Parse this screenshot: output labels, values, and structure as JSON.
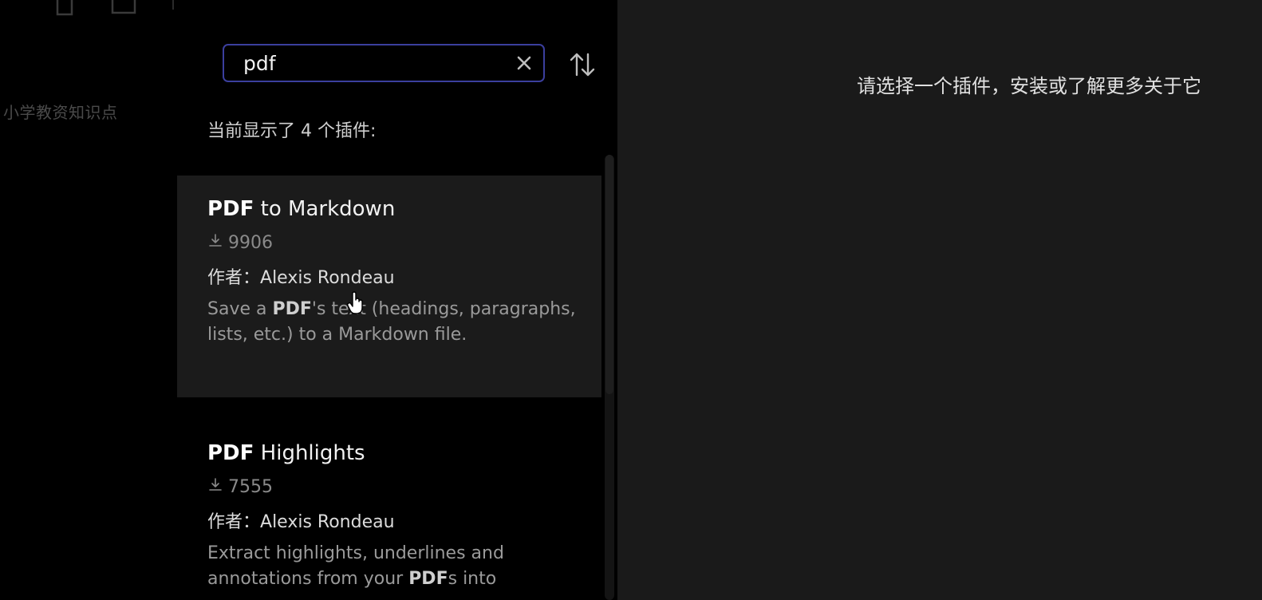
{
  "vault": {
    "name": "小学教资知识点"
  },
  "search": {
    "value": "pdf",
    "placeholder": ""
  },
  "results": {
    "count_text": "当前显示了 4 个插件:",
    "author_prefix": "作者：",
    "items": [
      {
        "title_highlight": "PDF",
        "title_rest": " to Markdown",
        "downloads": "9906",
        "author": "Alexis Rondeau",
        "desc_pre": "Save a ",
        "desc_highlight": "PDF",
        "desc_post": "'s text (headings, paragraphs, lists, etc.) to a Markdown file."
      },
      {
        "title_highlight": "PDF",
        "title_rest": " Highlights",
        "downloads": "7555",
        "author": "Alexis Rondeau",
        "desc_pre": "Extract highlights, underlines and annotations from your ",
        "desc_highlight": "PDF",
        "desc_post": "s into"
      }
    ]
  },
  "detail": {
    "empty_text": "请选择一个插件，安装或了解更多关于它"
  },
  "icons": {
    "new_note": "new-note-icon",
    "new_folder": "new-folder-icon",
    "clear": "close-icon",
    "sort": "sort-icon",
    "download": "download-icon",
    "cursor": "hand-pointer-cursor"
  },
  "colors": {
    "search_border": "#3b3f9e",
    "selected_card": "#1b1b1b",
    "detail_background": "#1a1a1a"
  }
}
